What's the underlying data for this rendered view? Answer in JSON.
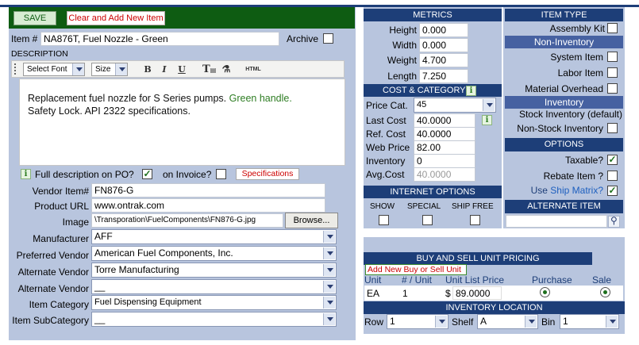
{
  "toolbar": {
    "save_label": "SAVE",
    "clear_label": "Clear and Add New Item"
  },
  "item": {
    "label": "Item #",
    "value": "NA876T, Fuel Nozzle - Green",
    "archive_label": "Archive"
  },
  "description": {
    "label": "DESCRIPTION",
    "font_select": "Select Font",
    "size_select": "Size",
    "bold": "B",
    "italic": "I",
    "underline": "U",
    "html": "HTML",
    "text_plain": "Replacement fuel nozzle for S Series pumps. ",
    "text_green": "Green handle.",
    "text_line2": "Safety Lock.  API 2322 specifications."
  },
  "po": {
    "info": "i",
    "full_desc_label": "Full description on PO?",
    "invoice_label": "on Invoice?",
    "specs_label": "Specifications"
  },
  "fields": {
    "vendor_item_label": "Vendor Item#",
    "vendor_item": "FN876-G",
    "product_url_label": "Product URL",
    "product_url": "www.ontrak.com",
    "image_label": "Image",
    "image_path": "\\Transporation\\FuelComponents\\FN876-G.jpg",
    "browse": "Browse...",
    "manufacturer_label": "Manufacturer",
    "manufacturer": "AFF",
    "preferred_vendor_label": "Preferred Vendor",
    "preferred_vendor": "American Fuel Components, Inc.",
    "alternate_vendor_label": "Alternate Vendor",
    "alternate_vendor": "Torre Manufacturing",
    "alternate_vendor2_label": "Alternate Vendor",
    "alternate_vendor2": "__",
    "item_category_label": "Item Category",
    "item_category": "Fuel Dispensing Equipment",
    "item_subcategory_label": "Item SubCategory",
    "item_subcategory": "__"
  },
  "metrics": {
    "title": "METRICS",
    "height_label": "Height",
    "height": "0.000",
    "width_label": "Width",
    "width": "0.000",
    "weight_label": "Weight",
    "weight": "4.700",
    "length_label": "Length",
    "length": "7.250"
  },
  "cost": {
    "title": "COST & CATEGORY",
    "info": "i",
    "price_cat_label": "Price Cat.",
    "price_cat": "45",
    "last_cost_label": "Last Cost",
    "last_cost": "40.0000",
    "ref_cost_label": "Ref. Cost",
    "ref_cost": "40.0000",
    "web_price_label": "Web Price",
    "web_price": "82.00",
    "inventory_label": "Inventory",
    "inventory": "0",
    "avg_cost_label": "Avg.Cost",
    "avg_cost": "40.0000"
  },
  "internet": {
    "title": "INTERNET OPTIONS",
    "show": "SHOW",
    "special": "SPECIAL",
    "ship_free": "SHIP FREE"
  },
  "item_type": {
    "title": "ITEM TYPE",
    "assembly_kit": "Assembly Kit",
    "non_inventory": "Non-Inventory",
    "system_item": "System Item",
    "labor_item": "Labor Item",
    "material_overhead": "Material Overhead",
    "inventory": "Inventory",
    "stock_inventory": "Stock Inventory (default)",
    "non_stock_inventory": "Non-Stock Inventory"
  },
  "options": {
    "title": "OPTIONS",
    "taxable": "Taxable?",
    "rebate": "Rebate Item ?",
    "use_label": "Use ",
    "ship_matrix": "Ship Matrix?"
  },
  "alternate_item": {
    "title": "ALTERNATE ITEM"
  },
  "pricing": {
    "title": "BUY AND SELL UNIT PRICING",
    "add_new": "Add New Buy or Sell Unit",
    "col_unit": "Unit",
    "col_per_unit": "# / Unit",
    "col_list_price": "Unit List Price",
    "col_purchase": "Purchase",
    "col_sale": "Sale",
    "row_unit": "EA",
    "row_per_unit": "1",
    "row_currency": "$",
    "row_price": "89.0000"
  },
  "location": {
    "title": "INVENTORY LOCATION",
    "row_label": "Row",
    "row_value": "1",
    "shelf_label": "Shelf",
    "shelf_value": "A",
    "bin_label": "Bin",
    "bin_value": "1"
  },
  "colors": {
    "header_blue": "#1d3e78",
    "panel_blue": "#b8c5de",
    "save_green": "#0e5c12",
    "alert_red": "#cc0000"
  }
}
